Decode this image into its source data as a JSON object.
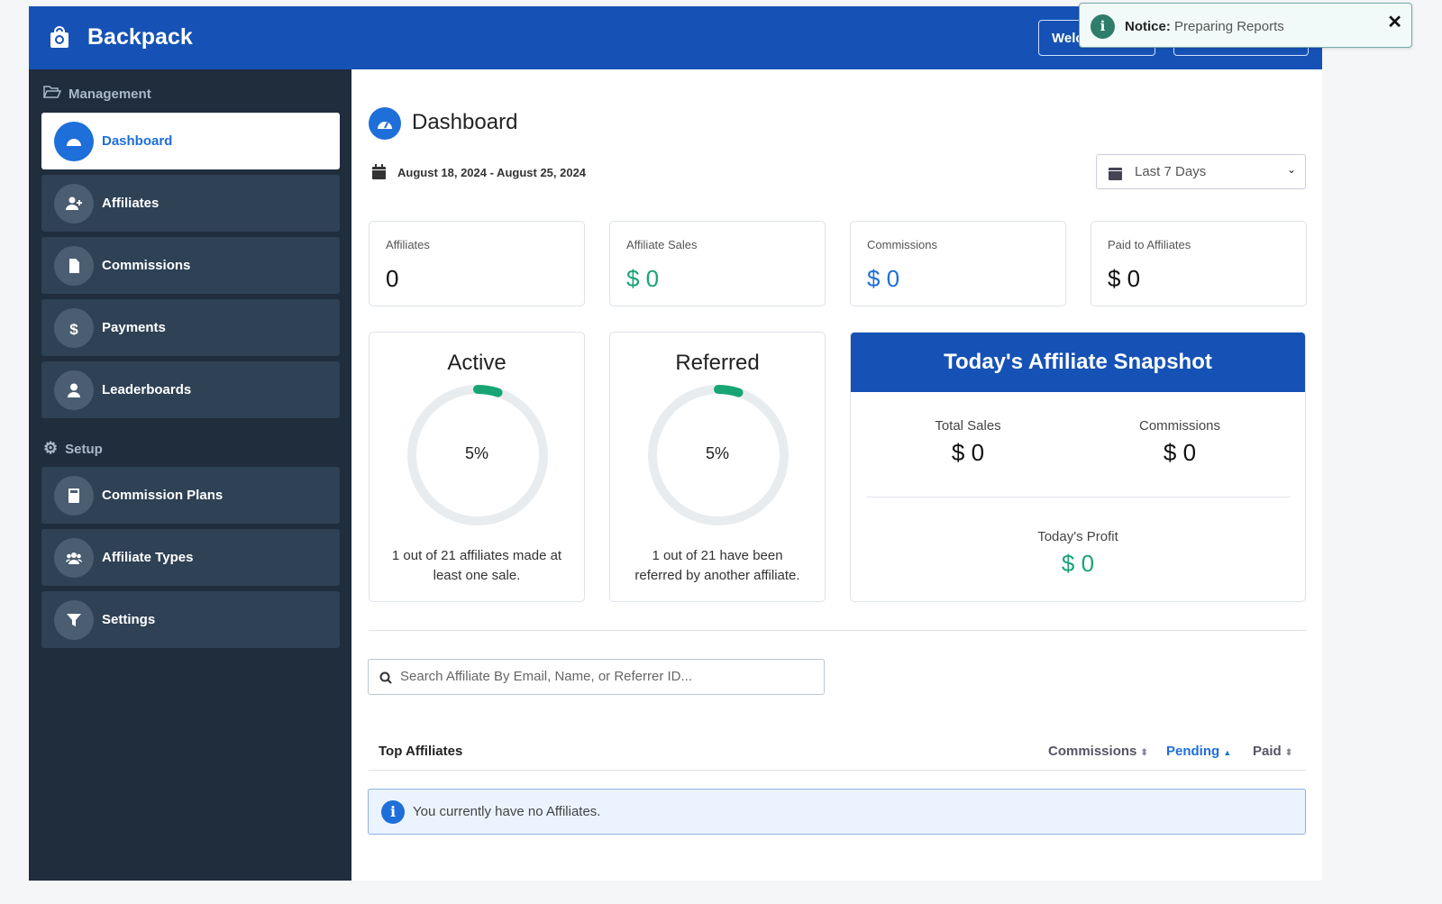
{
  "header": {
    "brand": "Backpack",
    "welcome_button": "Welcome",
    "account_button": ""
  },
  "notice": {
    "label": "Notice:",
    "message": "Preparing Reports"
  },
  "sidebar": {
    "management_label": "Management",
    "management_items": [
      {
        "label": "Dashboard",
        "icon": "gauge-icon",
        "active": true
      },
      {
        "label": "Affiliates",
        "icon": "user-plus-icon"
      },
      {
        "label": "Commissions",
        "icon": "file-icon"
      },
      {
        "label": "Payments",
        "icon": "dollar-icon"
      },
      {
        "label": "Leaderboards",
        "icon": "user-icon"
      }
    ],
    "setup_label": "Setup",
    "setup_items": [
      {
        "label": "Commission Plans",
        "icon": "calculator-icon"
      },
      {
        "label": "Affiliate Types",
        "icon": "users-icon"
      },
      {
        "label": "Settings",
        "icon": "filter-icon"
      }
    ]
  },
  "main": {
    "title": "Dashboard",
    "date_range": "August 18, 2024 - August 25, 2024",
    "period_select": "Last 7 Days",
    "stats": [
      {
        "label": "Affiliates",
        "value": "0"
      },
      {
        "label": "Affiliate Sales",
        "value": "$ 0"
      },
      {
        "label": "Commissions",
        "value": "$ 0"
      },
      {
        "label": "Paid to Affiliates",
        "value": "$ 0"
      }
    ],
    "active": {
      "title": "Active",
      "percent": 5,
      "percent_label": "5%",
      "description": "1 out of 21 affiliates made at least one sale."
    },
    "referred": {
      "title": "Referred",
      "percent": 5,
      "percent_label": "5%",
      "description": "1 out of 21 have been referred by another affiliate."
    },
    "snapshot": {
      "title": "Today's Affiliate Snapshot",
      "total_sales_label": "Total Sales",
      "total_sales": "$ 0",
      "commissions_label": "Commissions",
      "commissions": "$ 0",
      "profit_label": "Today's Profit",
      "profit": "$ 0"
    },
    "search_placeholder": "Search Affiliate By Email, Name, or Referrer ID...",
    "table": {
      "title": "Top Affiliates",
      "columns": [
        "Commissions",
        "Pending",
        "Paid"
      ],
      "sorted_column": "Pending"
    },
    "empty_message": "You currently have no Affiliates."
  },
  "colors": {
    "header": "#1652b5",
    "sidebar": "#1f2d3d",
    "accent": "#1e6fd9",
    "success": "#1aa37a"
  }
}
